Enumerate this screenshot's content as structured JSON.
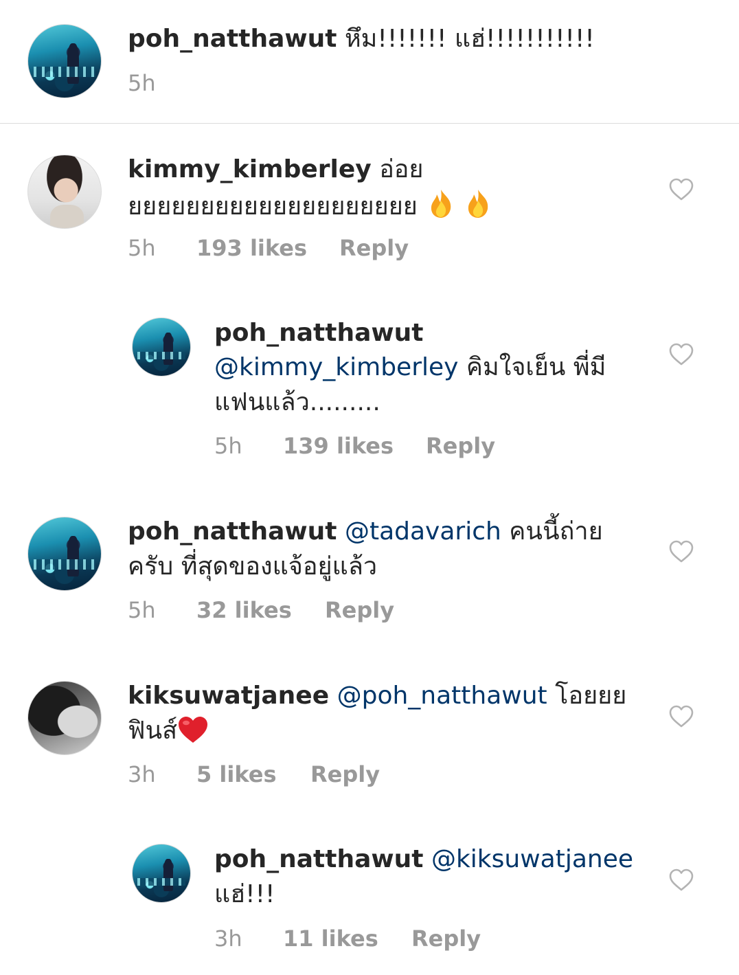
{
  "caption": {
    "username": "poh_natthawut",
    "text": "หึม!!!!!!! แฮ่!!!!!!!!!!!",
    "time": "5h"
  },
  "comments": [
    {
      "username": "kimmy_kimberley",
      "line1": "อ่อย",
      "line2": "ยยยยยยยยยยยยยยยยยยยย",
      "emoji": "fire-icon",
      "time": "5h",
      "likes": "193 likes",
      "reply": "Reply"
    },
    {
      "username": "poh_natthawut",
      "mention": "@kimmy_kimberley",
      "line1_rest": "คิมใจเย็น พี่มี",
      "line2": "แฟนแล้ว.........",
      "time": "5h",
      "likes": "139 likes",
      "reply": "Reply"
    },
    {
      "username": "poh_natthawut",
      "mention": "@tadavarich",
      "line1_rest": "คนนี้ถ่าย",
      "line2": "ครับ ที่สุดของแจ้อยู่แล้ว",
      "time": "5h",
      "likes": "32 likes",
      "reply": "Reply"
    },
    {
      "username": "kiksuwatjanee",
      "mention": "@poh_natthawut",
      "line1_rest": "โอยยย",
      "line2": "ฟินส์",
      "emoji": "red-heart-icon",
      "time": "3h",
      "likes": "5 likes",
      "reply": "Reply"
    },
    {
      "username": "poh_natthawut",
      "mention": "@kiksuwatjanee",
      "line2": "แฮ่!!!",
      "time": "3h",
      "likes": "11 likes",
      "reply": "Reply"
    }
  ],
  "colors": {
    "text": "#262626",
    "mention": "#003569",
    "meta": "#999999",
    "divider": "#dbdbdb",
    "heart_outline": "#b3b3b3",
    "emoji_heart": "#e0202c"
  }
}
